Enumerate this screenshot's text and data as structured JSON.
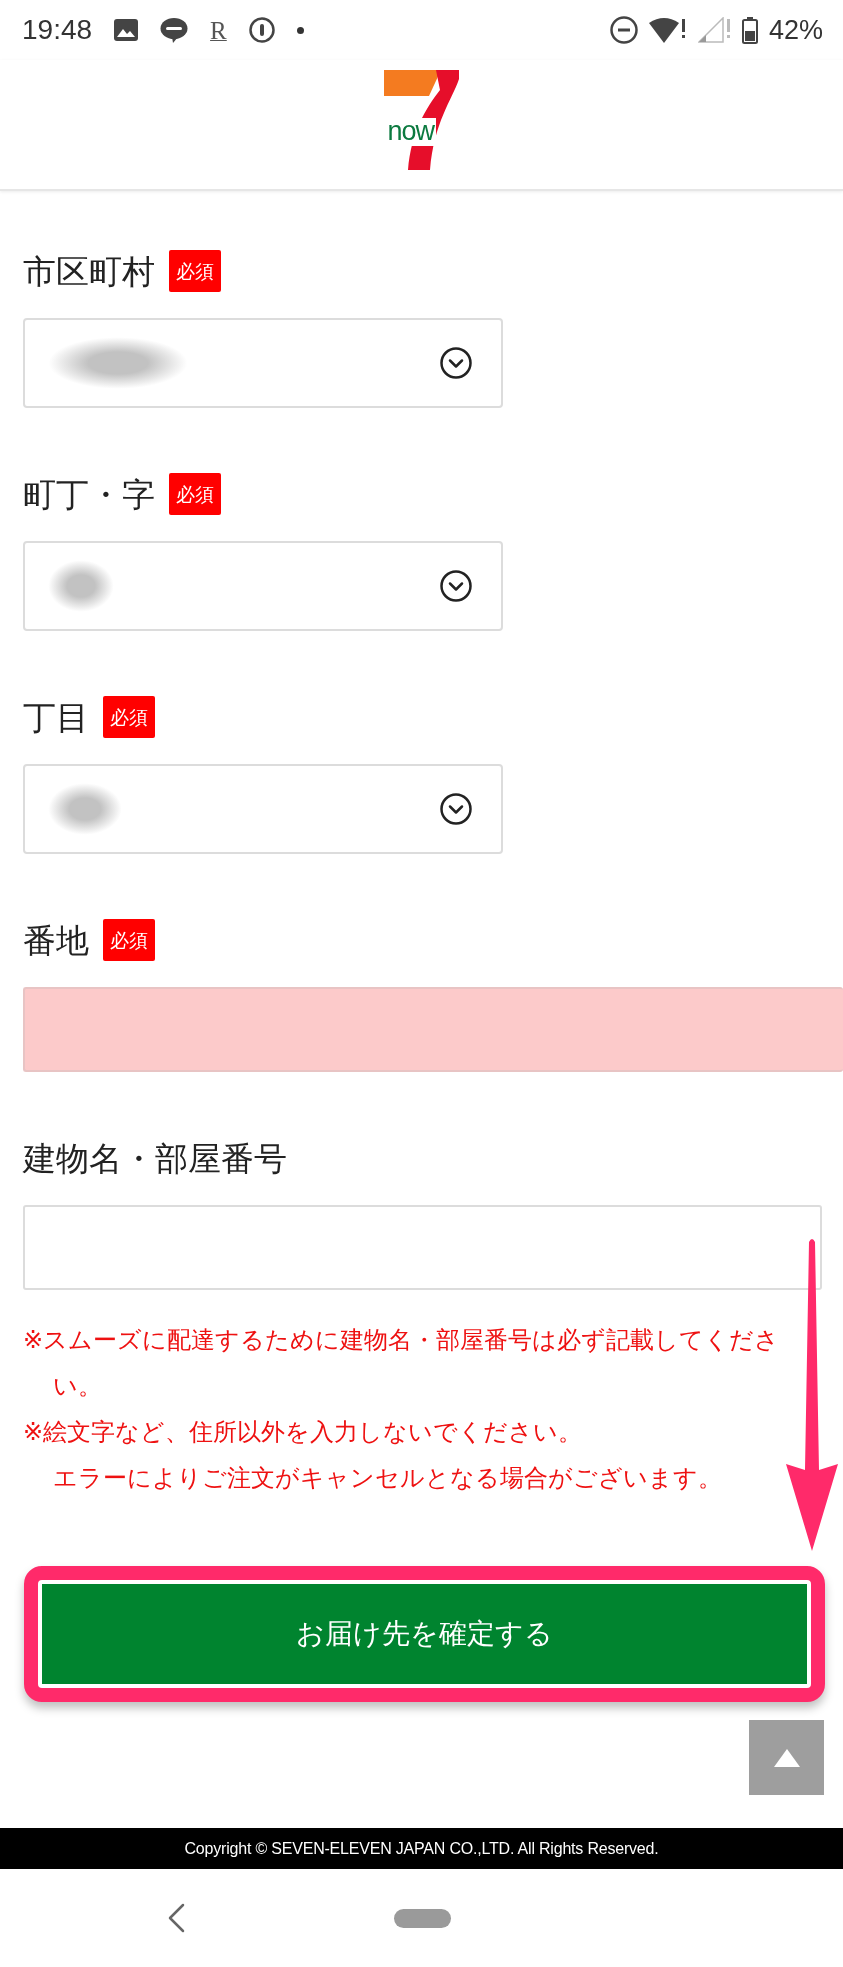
{
  "status_bar": {
    "time": "19:48",
    "notification_letter": "R",
    "battery": "42%"
  },
  "header": {
    "logo_text": "now"
  },
  "fields": [
    {
      "kind": "select",
      "label": "市区町村",
      "badge": "必須",
      "redacted": true
    },
    {
      "kind": "select",
      "label": "町丁・字",
      "badge": "必須",
      "redacted": true
    },
    {
      "kind": "select",
      "label": "丁目",
      "badge": "必須",
      "redacted": true
    },
    {
      "kind": "input",
      "label": "番地",
      "badge": "必須",
      "error": true
    },
    {
      "kind": "input",
      "label": "建物名・部屋番号",
      "error": false
    }
  ],
  "notes": [
    {
      "lines": [
        "※スムーズに配達するために建物名・部屋番号は必ず記載してください。"
      ]
    },
    {
      "lines": [
        "※絵文字など、住所以外を入力しないでください。",
        "エラーによりご注文がキャンセルとなる場合がございます。"
      ]
    }
  ],
  "confirm_button": {
    "label": "お届け先を確定する",
    "highlighted": true
  },
  "footer": {
    "copyright": "Copyright © SEVEN-ELEVEN JAPAN CO.,LTD. All Rights Reserved."
  }
}
